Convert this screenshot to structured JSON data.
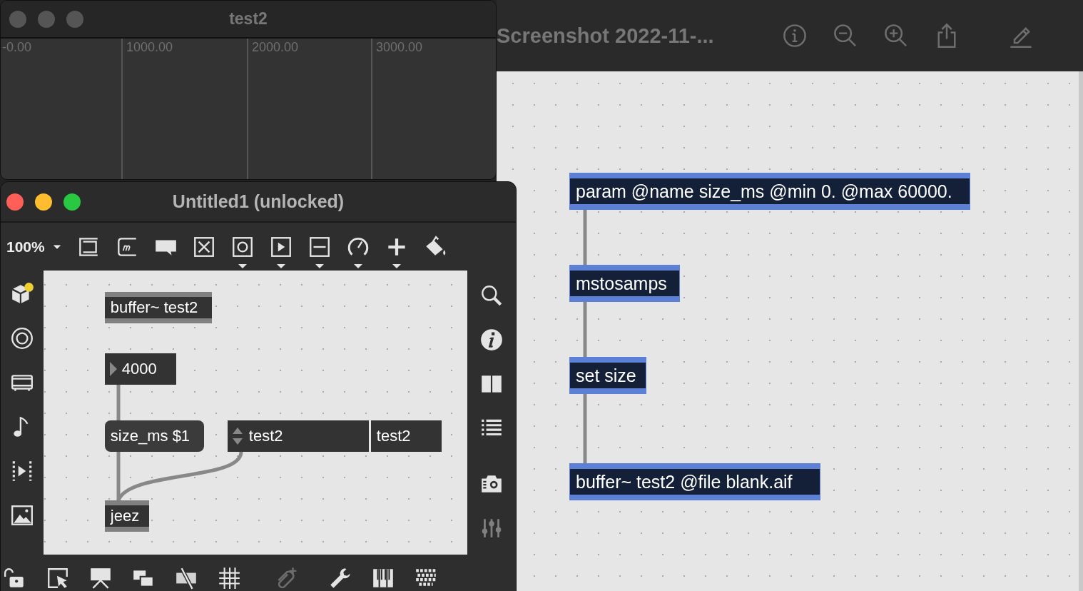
{
  "buffer_window": {
    "title": "test2",
    "active": false,
    "ruler_labels": [
      "-0.00",
      "1000.00",
      "2000.00",
      "3000.00"
    ]
  },
  "patcher_window": {
    "title": "Untitled1 (unlocked)",
    "active": true,
    "zoom": "100%",
    "objects": [
      {
        "kind": "object",
        "text": "buffer~ test2",
        "selected": false
      },
      {
        "kind": "number",
        "text": "4000",
        "selected": false
      },
      {
        "kind": "message",
        "text": "size_ms $1",
        "selected": false
      },
      {
        "kind": "menu",
        "text": "test2",
        "selected": false
      },
      {
        "kind": "attr",
        "text": "test2",
        "selected": false
      },
      {
        "kind": "object",
        "text": "jeez",
        "selected": false
      }
    ]
  },
  "preview_window": {
    "title": "Screenshot 2022-11-...",
    "objects": [
      {
        "kind": "object",
        "text": "param @name size_ms @min 0. @max 60000.",
        "selected": true
      },
      {
        "kind": "object",
        "text": "mstosamps",
        "selected": true
      },
      {
        "kind": "object",
        "text": "set size",
        "selected": true
      },
      {
        "kind": "object",
        "text": "buffer~ test2 @file blank.aif",
        "selected": true
      }
    ]
  }
}
